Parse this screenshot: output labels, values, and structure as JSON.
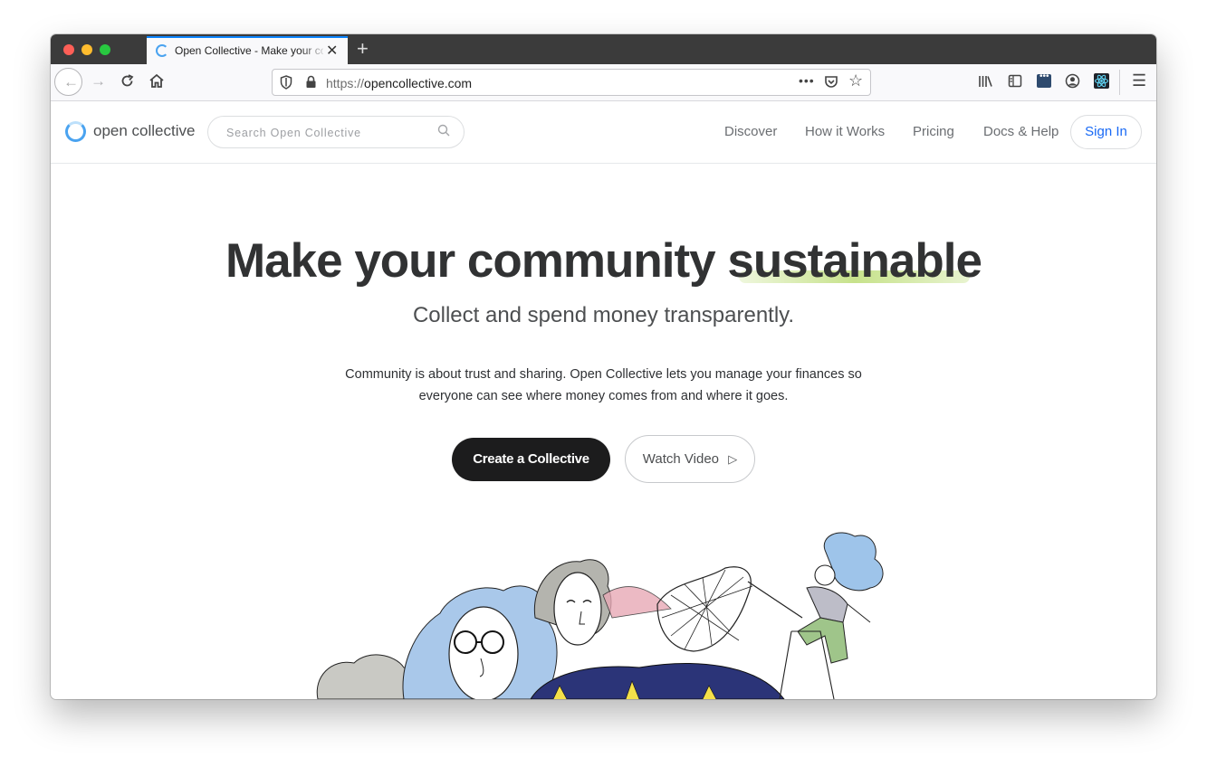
{
  "browser": {
    "tab_title": "Open Collective - Make your community sustainable",
    "tab_close": "✕",
    "new_tab": "+",
    "url_protocol": "https://",
    "url_host": "opencollective.com",
    "url_more": "•••"
  },
  "site": {
    "logo_text": "open collective",
    "search_placeholder": "Search Open Collective",
    "nav": [
      "Discover",
      "How it Works",
      "Pricing",
      "Docs & Help"
    ],
    "sign_in": "Sign In"
  },
  "hero": {
    "title_main": "Make your community ",
    "title_highlight": "sustainable",
    "subtitle": "Collect and spend money transparently.",
    "description": "Community is about trust and sharing. Open Collective lets you manage your finances so everyone can see where money comes from and where it goes.",
    "create_button": "Create a Collective",
    "watch_button": "Watch Video",
    "watch_icon": "▷"
  },
  "colors": {
    "accent": "#1869f5",
    "logo_blue": "#4aa3f0",
    "highlight_green": "#afd65a",
    "dark_button": "#1c1c1d"
  }
}
